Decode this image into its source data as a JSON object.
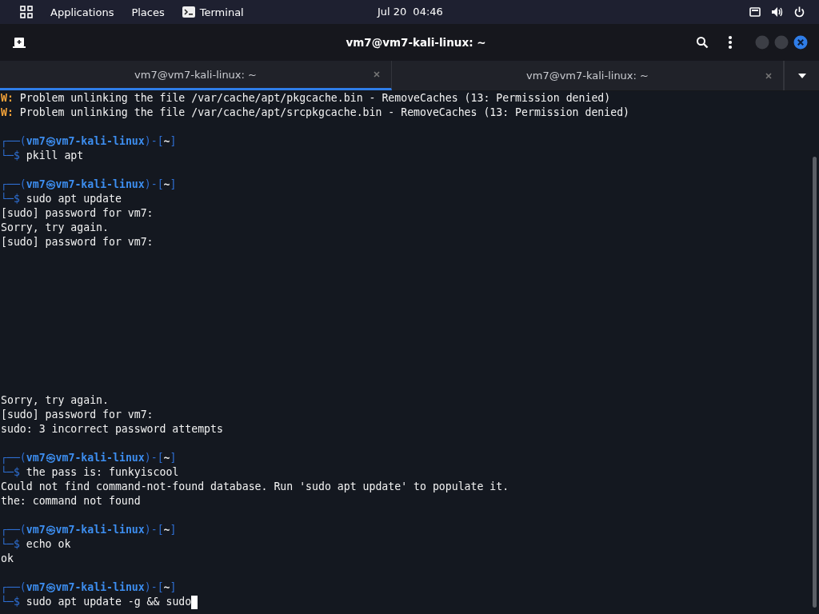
{
  "top_bar": {
    "menus": [
      "Applications",
      "Places"
    ],
    "app": "Terminal",
    "date": "Jul 20",
    "time": "04:46"
  },
  "window": {
    "title": "vm7@vm7-kali-linux: ~"
  },
  "tabs": [
    {
      "label": "vm7@vm7-kali-linux: ~",
      "selected": true
    },
    {
      "label": "vm7@vm7-kali-linux: ~",
      "selected": false
    }
  ],
  "terminal": {
    "lines": [
      {
        "kind": "warning",
        "tag": "W:",
        "text": "Problem unlinking the file /var/cache/apt/pkgcache.bin - RemoveCaches (13: Permission denied)"
      },
      {
        "kind": "warning",
        "tag": "W:",
        "text": "Problem unlinking the file /var/cache/apt/srcpkgcache.bin - RemoveCaches (13: Permission denied)"
      },
      {
        "kind": "blank"
      },
      {
        "kind": "prompt",
        "open": "┌──(",
        "user": "vm7㉿vm7-kali-linux",
        "mid": ")-[",
        "dir": "~",
        "close": "]"
      },
      {
        "kind": "command",
        "mark": "└─$",
        "text": "pkill apt",
        "cursor": false
      },
      {
        "kind": "blank"
      },
      {
        "kind": "prompt",
        "open": "┌──(",
        "user": "vm7㉿vm7-kali-linux",
        "mid": ")-[",
        "dir": "~",
        "close": "]"
      },
      {
        "kind": "command",
        "mark": "└─$",
        "text": "sudo apt update",
        "cursor": false
      },
      {
        "kind": "output",
        "text": "[sudo] password for vm7:"
      },
      {
        "kind": "output",
        "text": "Sorry, try again."
      },
      {
        "kind": "output",
        "text": "[sudo] password for vm7:"
      },
      {
        "kind": "blank"
      },
      {
        "kind": "blank"
      },
      {
        "kind": "blank"
      },
      {
        "kind": "blank"
      },
      {
        "kind": "blank"
      },
      {
        "kind": "blank"
      },
      {
        "kind": "blank"
      },
      {
        "kind": "blank"
      },
      {
        "kind": "blank"
      },
      {
        "kind": "blank"
      },
      {
        "kind": "output",
        "text": "Sorry, try again."
      },
      {
        "kind": "output",
        "text": "[sudo] password for vm7:"
      },
      {
        "kind": "output",
        "text": "sudo: 3 incorrect password attempts"
      },
      {
        "kind": "blank"
      },
      {
        "kind": "prompt",
        "open": "┌──(",
        "user": "vm7㉿vm7-kali-linux",
        "mid": ")-[",
        "dir": "~",
        "close": "]"
      },
      {
        "kind": "command",
        "mark": "└─$",
        "text": "the pass is: funkyiscool",
        "cursor": false
      },
      {
        "kind": "output",
        "text": "Could not find command-not-found database. Run 'sudo apt update' to populate it."
      },
      {
        "kind": "output",
        "text": "the: command not found"
      },
      {
        "kind": "blank"
      },
      {
        "kind": "prompt",
        "open": "┌──(",
        "user": "vm7㉿vm7-kali-linux",
        "mid": ")-[",
        "dir": "~",
        "close": "]"
      },
      {
        "kind": "command",
        "mark": "└─$",
        "text": "echo ok",
        "cursor": false
      },
      {
        "kind": "output",
        "text": "ok"
      },
      {
        "kind": "blank"
      },
      {
        "kind": "prompt",
        "open": "┌──(",
        "user": "vm7㉿vm7-kali-linux",
        "mid": ")-[",
        "dir": "~",
        "close": "]"
      },
      {
        "kind": "command",
        "mark": "└─$",
        "text": "sudo apt update -g && sudo",
        "cursor": true
      }
    ]
  }
}
